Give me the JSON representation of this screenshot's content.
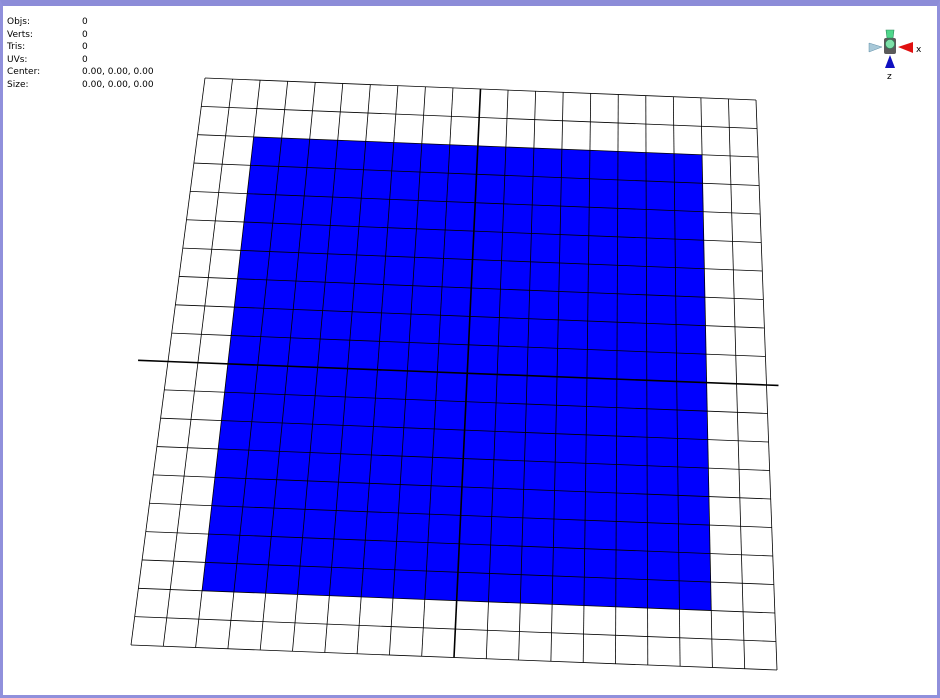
{
  "stats": [
    {
      "label": "Objs:",
      "value": "0"
    },
    {
      "label": "Verts:",
      "value": "0"
    },
    {
      "label": "Tris:",
      "value": "0"
    },
    {
      "label": "UVs:",
      "value": "0"
    },
    {
      "label": "Center:",
      "value": "0.00, 0.00, 0.00"
    },
    {
      "label": "Size:",
      "value": "0.00, 0.00, 0.00"
    }
  ],
  "gizmo": {
    "x_label": "x",
    "z_label": "z"
  },
  "colors": {
    "frame": "#8c8cd8",
    "plane_fill": "#0000ff",
    "grid_line": "#000000",
    "axis_x": "#e01010",
    "axis_z": "#1010c0",
    "gizmo_center": "#4fd68a",
    "gizmo_side": "#a8c8d8"
  }
}
